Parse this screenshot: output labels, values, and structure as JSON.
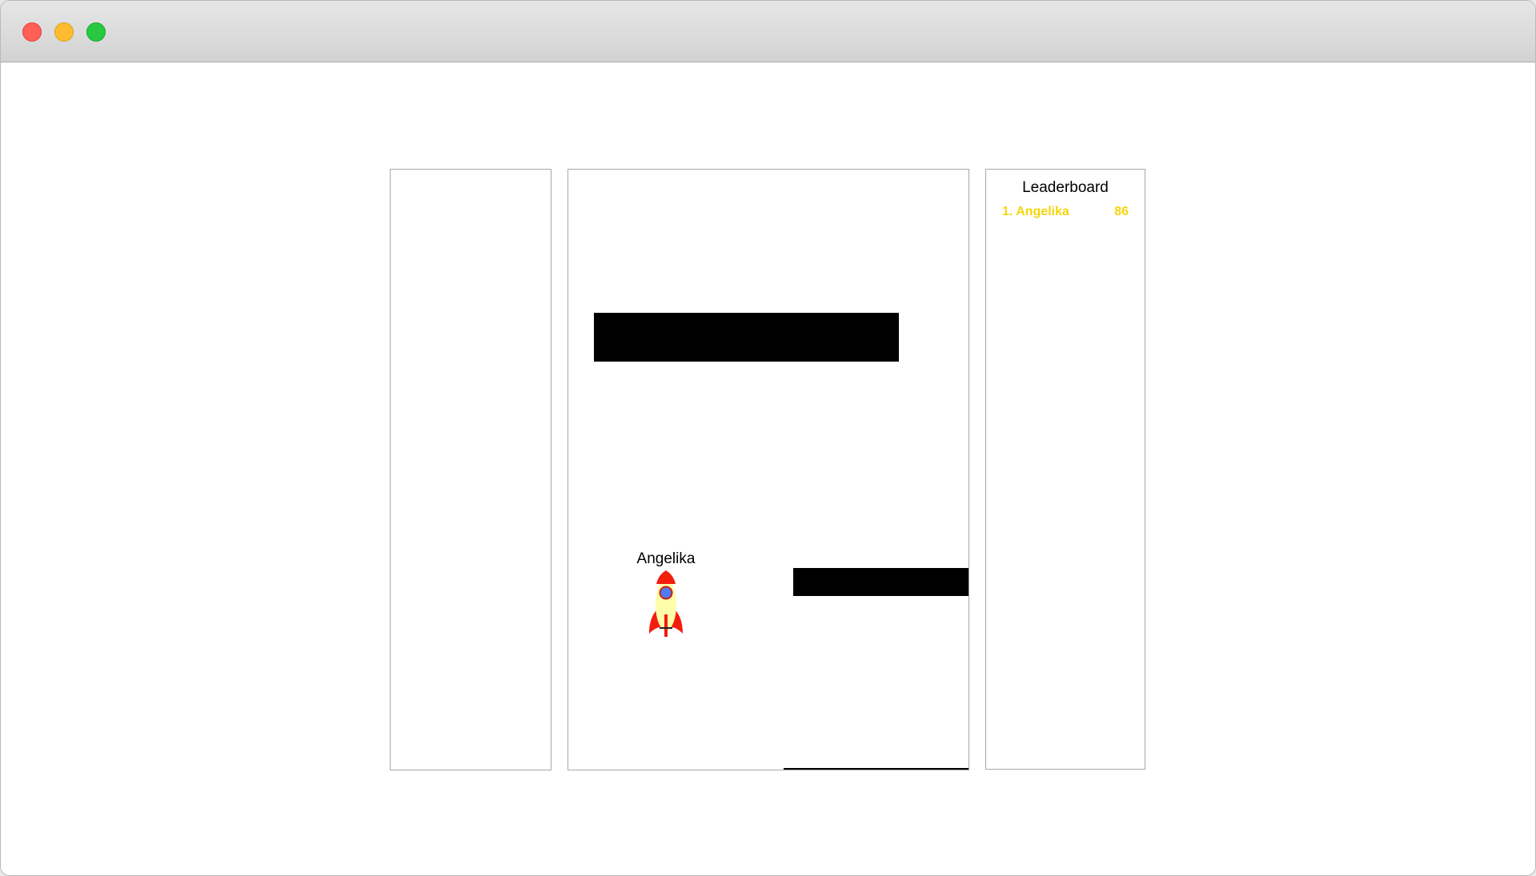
{
  "window": {
    "controls": [
      "close",
      "minimize",
      "zoom"
    ]
  },
  "leaderboard": {
    "title": "Leaderboard",
    "entries": [
      {
        "rank_name": "1. Angelika",
        "score": "86",
        "color": "#f5d50c"
      }
    ]
  },
  "game": {
    "player": {
      "name": "Angelika",
      "icon": "rocket-icon"
    },
    "obstacle_color": "#000000"
  }
}
